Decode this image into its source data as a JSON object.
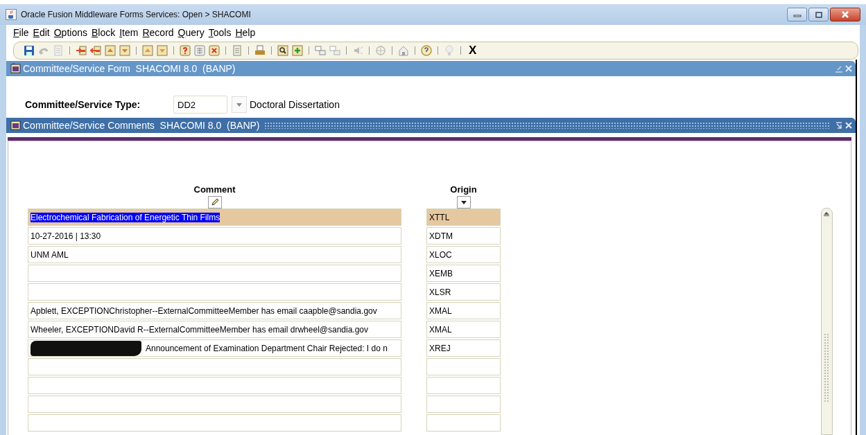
{
  "window": {
    "title": "Oracle Fusion Middleware Forms Services:  Open > SHACOMI"
  },
  "menu": [
    {
      "label": "File"
    },
    {
      "label": "Edit"
    },
    {
      "label": "Options"
    },
    {
      "label": "Block"
    },
    {
      "label": "Item"
    },
    {
      "label": "Record"
    },
    {
      "label": "Query"
    },
    {
      "label": "Tools"
    },
    {
      "label": "Help"
    }
  ],
  "toolbar": {
    "exit_label": "X"
  },
  "form_window": {
    "title": "Committee/Service Form  SHACOMI 8.0  (BANP)",
    "field_label": "Committee/Service Type:",
    "field_value": "DD2",
    "description": "Doctoral Dissertation"
  },
  "comments_window": {
    "title": "Committee/Service Comments  SHACOMI 8.0  (BANP)",
    "columns": [
      "Comment",
      "Origin"
    ],
    "rows": [
      {
        "comment": "Electrochemical Fabrication of Energetic Thin Films",
        "origin": "XTTL",
        "selected": true
      },
      {
        "comment": "10-27-2016 | 13:30",
        "origin": "XDTM",
        "selected": false
      },
      {
        "comment": "UNM AML",
        "origin": "XLOC",
        "selected": false
      },
      {
        "origin": "XEMB",
        "selected": false
      },
      {
        "origin": "XLSR",
        "selected": false
      },
      {
        "comment": "Apblett, EXCEPTIONChristopher--ExternalCommitteeMember has email caapble@sandia.gov",
        "origin": "XMAL",
        "selected": false
      },
      {
        "comment": "Wheeler, EXCEPTIONDavid R--ExternalCommitteeMember has email drwheel@sandia.gov",
        "origin": "XMAL",
        "selected": false
      },
      {
        "comment": "Announcement of Examination Department Chair Rejected: I do n",
        "origin": "XREJ",
        "selected": false,
        "redacted": true
      },
      {
        "selected": false
      },
      {
        "selected": false
      },
      {
        "selected": false
      },
      {
        "selected": false
      }
    ]
  }
}
